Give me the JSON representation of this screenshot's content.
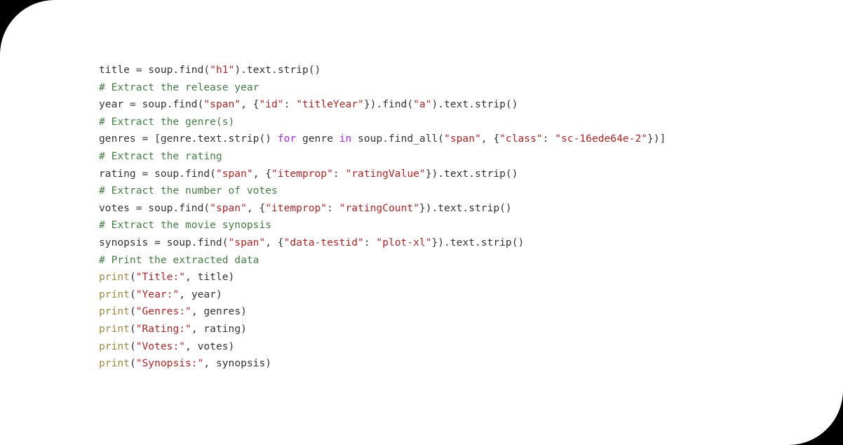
{
  "panel": {
    "background_color": "#ffffff",
    "page_background_color": "#000000",
    "corner_radius_px": 78,
    "rounded_corners": [
      "top-left",
      "bottom-right"
    ]
  },
  "syntax_colors": {
    "plain": "#333333",
    "comment": "#408040",
    "string": "#ba2121",
    "keyword": "#aa22ff",
    "builtin": "#a0893d"
  },
  "code": {
    "language": "python",
    "lines": [
      {
        "index": 1,
        "text": "title = soup.find(\"h1\").text.strip()",
        "tokens": [
          {
            "t": "title = soup.find(",
            "c": "plain"
          },
          {
            "t": "\"h1\"",
            "c": "string"
          },
          {
            "t": ").text.strip()",
            "c": "plain"
          }
        ]
      },
      {
        "index": 2,
        "text": "# Extract the release year",
        "tokens": [
          {
            "t": "# Extract the release year",
            "c": "comment"
          }
        ]
      },
      {
        "index": 3,
        "text": "year = soup.find(\"span\", {\"id\": \"titleYear\"}).find(\"a\").text.strip()",
        "tokens": [
          {
            "t": "year = soup.find(",
            "c": "plain"
          },
          {
            "t": "\"span\"",
            "c": "string"
          },
          {
            "t": ", {",
            "c": "plain"
          },
          {
            "t": "\"id\"",
            "c": "string"
          },
          {
            "t": ": ",
            "c": "plain"
          },
          {
            "t": "\"titleYear\"",
            "c": "string"
          },
          {
            "t": "}).find(",
            "c": "plain"
          },
          {
            "t": "\"a\"",
            "c": "string"
          },
          {
            "t": ").text.strip()",
            "c": "plain"
          }
        ]
      },
      {
        "index": 4,
        "text": "# Extract the genre(s)",
        "tokens": [
          {
            "t": "# Extract the genre(s)",
            "c": "comment"
          }
        ]
      },
      {
        "index": 5,
        "text": "genres = [genre.text.strip() for genre in soup.find_all(\"span\", {\"class\": \"sc-16ede64e-2\"})]",
        "tokens": [
          {
            "t": "genres = [genre.text.strip() ",
            "c": "plain"
          },
          {
            "t": "for",
            "c": "keyword"
          },
          {
            "t": " genre ",
            "c": "plain"
          },
          {
            "t": "in",
            "c": "keyword"
          },
          {
            "t": " soup.find_all(",
            "c": "plain"
          },
          {
            "t": "\"span\"",
            "c": "string"
          },
          {
            "t": ", {",
            "c": "plain"
          },
          {
            "t": "\"class\"",
            "c": "string"
          },
          {
            "t": ": ",
            "c": "plain"
          },
          {
            "t": "\"sc-16ede64e-2\"",
            "c": "string"
          },
          {
            "t": "})]",
            "c": "plain"
          }
        ]
      },
      {
        "index": 6,
        "text": "# Extract the rating",
        "tokens": [
          {
            "t": "# Extract the rating",
            "c": "comment"
          }
        ]
      },
      {
        "index": 7,
        "text": "rating = soup.find(\"span\", {\"itemprop\": \"ratingValue\"}).text.strip()",
        "tokens": [
          {
            "t": "rating = soup.find(",
            "c": "plain"
          },
          {
            "t": "\"span\"",
            "c": "string"
          },
          {
            "t": ", {",
            "c": "plain"
          },
          {
            "t": "\"itemprop\"",
            "c": "string"
          },
          {
            "t": ": ",
            "c": "plain"
          },
          {
            "t": "\"ratingValue\"",
            "c": "string"
          },
          {
            "t": "}).text.strip()",
            "c": "plain"
          }
        ]
      },
      {
        "index": 8,
        "text": "# Extract the number of votes",
        "tokens": [
          {
            "t": "# Extract the number of votes",
            "c": "comment"
          }
        ]
      },
      {
        "index": 9,
        "text": "votes = soup.find(\"span\", {\"itemprop\": \"ratingCount\"}).text.strip()",
        "tokens": [
          {
            "t": "votes = soup.find(",
            "c": "plain"
          },
          {
            "t": "\"span\"",
            "c": "string"
          },
          {
            "t": ", {",
            "c": "plain"
          },
          {
            "t": "\"itemprop\"",
            "c": "string"
          },
          {
            "t": ": ",
            "c": "plain"
          },
          {
            "t": "\"ratingCount\"",
            "c": "string"
          },
          {
            "t": "}).text.strip()",
            "c": "plain"
          }
        ]
      },
      {
        "index": 10,
        "text": "# Extract the movie synopsis",
        "tokens": [
          {
            "t": "# Extract the movie synopsis",
            "c": "comment"
          }
        ]
      },
      {
        "index": 11,
        "text": "synopsis = soup.find(\"span\", {\"data-testid\": \"plot-xl\"}).text.strip()",
        "tokens": [
          {
            "t": "synopsis = soup.find(",
            "c": "plain"
          },
          {
            "t": "\"span\"",
            "c": "string"
          },
          {
            "t": ", {",
            "c": "plain"
          },
          {
            "t": "\"data-testid\"",
            "c": "string"
          },
          {
            "t": ": ",
            "c": "plain"
          },
          {
            "t": "\"plot-xl\"",
            "c": "string"
          },
          {
            "t": "}).text.strip()",
            "c": "plain"
          }
        ]
      },
      {
        "index": 12,
        "text": "# Print the extracted data",
        "tokens": [
          {
            "t": "# Print the extracted data",
            "c": "comment"
          }
        ]
      },
      {
        "index": 13,
        "text": "print(\"Title:\", title)",
        "tokens": [
          {
            "t": "print",
            "c": "builtin"
          },
          {
            "t": "(",
            "c": "plain"
          },
          {
            "t": "\"Title:\"",
            "c": "string"
          },
          {
            "t": ", title)",
            "c": "plain"
          }
        ]
      },
      {
        "index": 14,
        "text": "print(\"Year:\", year)",
        "tokens": [
          {
            "t": "print",
            "c": "builtin"
          },
          {
            "t": "(",
            "c": "plain"
          },
          {
            "t": "\"Year:\"",
            "c": "string"
          },
          {
            "t": ", year)",
            "c": "plain"
          }
        ]
      },
      {
        "index": 15,
        "text": "print(\"Genres:\", genres)",
        "tokens": [
          {
            "t": "print",
            "c": "builtin"
          },
          {
            "t": "(",
            "c": "plain"
          },
          {
            "t": "\"Genres:\"",
            "c": "string"
          },
          {
            "t": ", genres)",
            "c": "plain"
          }
        ]
      },
      {
        "index": 16,
        "text": "print(\"Rating:\", rating)",
        "tokens": [
          {
            "t": "print",
            "c": "builtin"
          },
          {
            "t": "(",
            "c": "plain"
          },
          {
            "t": "\"Rating:\"",
            "c": "string"
          },
          {
            "t": ", rating)",
            "c": "plain"
          }
        ]
      },
      {
        "index": 17,
        "text": "print(\"Votes:\", votes)",
        "tokens": [
          {
            "t": "print",
            "c": "builtin"
          },
          {
            "t": "(",
            "c": "plain"
          },
          {
            "t": "\"Votes:\"",
            "c": "string"
          },
          {
            "t": ", votes)",
            "c": "plain"
          }
        ]
      },
      {
        "index": 18,
        "text": "print(\"Synopsis:\", synopsis)",
        "tokens": [
          {
            "t": "print",
            "c": "builtin"
          },
          {
            "t": "(",
            "c": "plain"
          },
          {
            "t": "\"Synopsis:\"",
            "c": "string"
          },
          {
            "t": ", synopsis)",
            "c": "plain"
          }
        ]
      }
    ]
  }
}
